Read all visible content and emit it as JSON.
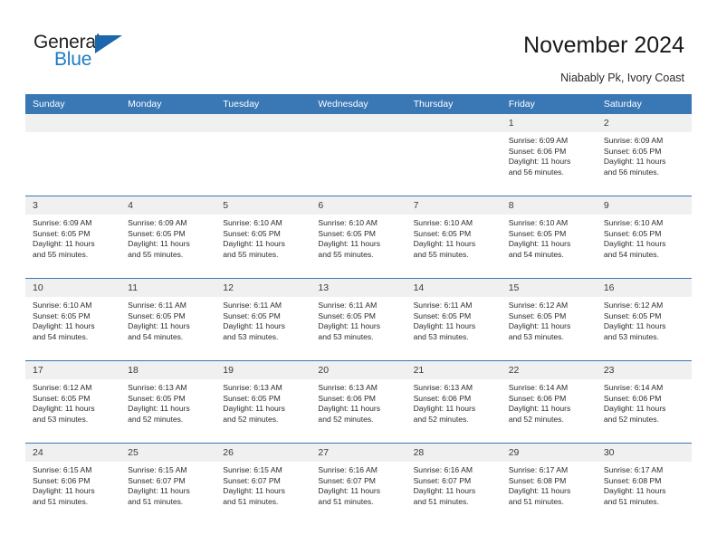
{
  "brand": {
    "name_top": "General",
    "name_bottom": "Blue",
    "triangle_color": "#1c66ab",
    "text_color_top": "#231f20",
    "text_color_bottom": "#1c7cc4"
  },
  "header": {
    "title": "November 2024",
    "subtitle": "Niabably Pk, Ivory Coast"
  },
  "theme": {
    "header_bg": "#3a77b5",
    "daynum_bg": "#f0f0f0",
    "rule_color": "#3a77b5",
    "body_text": "#2b2b2b"
  },
  "calendar": {
    "weekday_headers": [
      "Sunday",
      "Monday",
      "Tuesday",
      "Wednesday",
      "Thursday",
      "Friday",
      "Saturday"
    ],
    "weeks": [
      [
        {
          "day": "",
          "empty": true
        },
        {
          "day": "",
          "empty": true
        },
        {
          "day": "",
          "empty": true
        },
        {
          "day": "",
          "empty": true
        },
        {
          "day": "",
          "empty": true
        },
        {
          "day": "1",
          "sunrise": "Sunrise: 6:09 AM",
          "sunset": "Sunset: 6:06 PM",
          "daylight_l1": "Daylight: 11 hours",
          "daylight_l2": "and 56 minutes."
        },
        {
          "day": "2",
          "sunrise": "Sunrise: 6:09 AM",
          "sunset": "Sunset: 6:05 PM",
          "daylight_l1": "Daylight: 11 hours",
          "daylight_l2": "and 56 minutes."
        }
      ],
      [
        {
          "day": "3",
          "sunrise": "Sunrise: 6:09 AM",
          "sunset": "Sunset: 6:05 PM",
          "daylight_l1": "Daylight: 11 hours",
          "daylight_l2": "and 55 minutes."
        },
        {
          "day": "4",
          "sunrise": "Sunrise: 6:09 AM",
          "sunset": "Sunset: 6:05 PM",
          "daylight_l1": "Daylight: 11 hours",
          "daylight_l2": "and 55 minutes."
        },
        {
          "day": "5",
          "sunrise": "Sunrise: 6:10 AM",
          "sunset": "Sunset: 6:05 PM",
          "daylight_l1": "Daylight: 11 hours",
          "daylight_l2": "and 55 minutes."
        },
        {
          "day": "6",
          "sunrise": "Sunrise: 6:10 AM",
          "sunset": "Sunset: 6:05 PM",
          "daylight_l1": "Daylight: 11 hours",
          "daylight_l2": "and 55 minutes."
        },
        {
          "day": "7",
          "sunrise": "Sunrise: 6:10 AM",
          "sunset": "Sunset: 6:05 PM",
          "daylight_l1": "Daylight: 11 hours",
          "daylight_l2": "and 55 minutes."
        },
        {
          "day": "8",
          "sunrise": "Sunrise: 6:10 AM",
          "sunset": "Sunset: 6:05 PM",
          "daylight_l1": "Daylight: 11 hours",
          "daylight_l2": "and 54 minutes."
        },
        {
          "day": "9",
          "sunrise": "Sunrise: 6:10 AM",
          "sunset": "Sunset: 6:05 PM",
          "daylight_l1": "Daylight: 11 hours",
          "daylight_l2": "and 54 minutes."
        }
      ],
      [
        {
          "day": "10",
          "sunrise": "Sunrise: 6:10 AM",
          "sunset": "Sunset: 6:05 PM",
          "daylight_l1": "Daylight: 11 hours",
          "daylight_l2": "and 54 minutes."
        },
        {
          "day": "11",
          "sunrise": "Sunrise: 6:11 AM",
          "sunset": "Sunset: 6:05 PM",
          "daylight_l1": "Daylight: 11 hours",
          "daylight_l2": "and 54 minutes."
        },
        {
          "day": "12",
          "sunrise": "Sunrise: 6:11 AM",
          "sunset": "Sunset: 6:05 PM",
          "daylight_l1": "Daylight: 11 hours",
          "daylight_l2": "and 53 minutes."
        },
        {
          "day": "13",
          "sunrise": "Sunrise: 6:11 AM",
          "sunset": "Sunset: 6:05 PM",
          "daylight_l1": "Daylight: 11 hours",
          "daylight_l2": "and 53 minutes."
        },
        {
          "day": "14",
          "sunrise": "Sunrise: 6:11 AM",
          "sunset": "Sunset: 6:05 PM",
          "daylight_l1": "Daylight: 11 hours",
          "daylight_l2": "and 53 minutes."
        },
        {
          "day": "15",
          "sunrise": "Sunrise: 6:12 AM",
          "sunset": "Sunset: 6:05 PM",
          "daylight_l1": "Daylight: 11 hours",
          "daylight_l2": "and 53 minutes."
        },
        {
          "day": "16",
          "sunrise": "Sunrise: 6:12 AM",
          "sunset": "Sunset: 6:05 PM",
          "daylight_l1": "Daylight: 11 hours",
          "daylight_l2": "and 53 minutes."
        }
      ],
      [
        {
          "day": "17",
          "sunrise": "Sunrise: 6:12 AM",
          "sunset": "Sunset: 6:05 PM",
          "daylight_l1": "Daylight: 11 hours",
          "daylight_l2": "and 53 minutes."
        },
        {
          "day": "18",
          "sunrise": "Sunrise: 6:13 AM",
          "sunset": "Sunset: 6:05 PM",
          "daylight_l1": "Daylight: 11 hours",
          "daylight_l2": "and 52 minutes."
        },
        {
          "day": "19",
          "sunrise": "Sunrise: 6:13 AM",
          "sunset": "Sunset: 6:05 PM",
          "daylight_l1": "Daylight: 11 hours",
          "daylight_l2": "and 52 minutes."
        },
        {
          "day": "20",
          "sunrise": "Sunrise: 6:13 AM",
          "sunset": "Sunset: 6:06 PM",
          "daylight_l1": "Daylight: 11 hours",
          "daylight_l2": "and 52 minutes."
        },
        {
          "day": "21",
          "sunrise": "Sunrise: 6:13 AM",
          "sunset": "Sunset: 6:06 PM",
          "daylight_l1": "Daylight: 11 hours",
          "daylight_l2": "and 52 minutes."
        },
        {
          "day": "22",
          "sunrise": "Sunrise: 6:14 AM",
          "sunset": "Sunset: 6:06 PM",
          "daylight_l1": "Daylight: 11 hours",
          "daylight_l2": "and 52 minutes."
        },
        {
          "day": "23",
          "sunrise": "Sunrise: 6:14 AM",
          "sunset": "Sunset: 6:06 PM",
          "daylight_l1": "Daylight: 11 hours",
          "daylight_l2": "and 52 minutes."
        }
      ],
      [
        {
          "day": "24",
          "sunrise": "Sunrise: 6:15 AM",
          "sunset": "Sunset: 6:06 PM",
          "daylight_l1": "Daylight: 11 hours",
          "daylight_l2": "and 51 minutes."
        },
        {
          "day": "25",
          "sunrise": "Sunrise: 6:15 AM",
          "sunset": "Sunset: 6:07 PM",
          "daylight_l1": "Daylight: 11 hours",
          "daylight_l2": "and 51 minutes."
        },
        {
          "day": "26",
          "sunrise": "Sunrise: 6:15 AM",
          "sunset": "Sunset: 6:07 PM",
          "daylight_l1": "Daylight: 11 hours",
          "daylight_l2": "and 51 minutes."
        },
        {
          "day": "27",
          "sunrise": "Sunrise: 6:16 AM",
          "sunset": "Sunset: 6:07 PM",
          "daylight_l1": "Daylight: 11 hours",
          "daylight_l2": "and 51 minutes."
        },
        {
          "day": "28",
          "sunrise": "Sunrise: 6:16 AM",
          "sunset": "Sunset: 6:07 PM",
          "daylight_l1": "Daylight: 11 hours",
          "daylight_l2": "and 51 minutes."
        },
        {
          "day": "29",
          "sunrise": "Sunrise: 6:17 AM",
          "sunset": "Sunset: 6:08 PM",
          "daylight_l1": "Daylight: 11 hours",
          "daylight_l2": "and 51 minutes."
        },
        {
          "day": "30",
          "sunrise": "Sunrise: 6:17 AM",
          "sunset": "Sunset: 6:08 PM",
          "daylight_l1": "Daylight: 11 hours",
          "daylight_l2": "and 51 minutes."
        }
      ]
    ]
  }
}
